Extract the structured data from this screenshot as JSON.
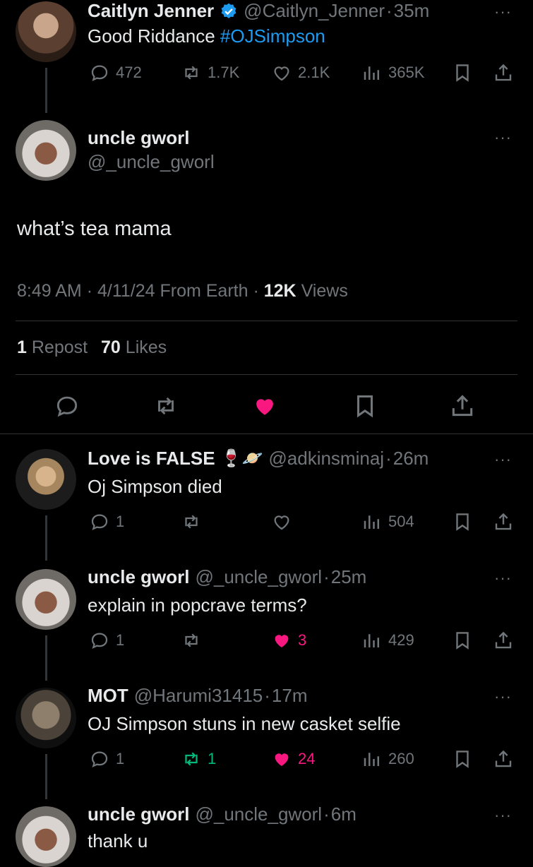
{
  "posts": [
    {
      "name": "Caitlyn Jenner",
      "handle": "@Caitlyn_Jenner",
      "time": "35m",
      "text": "Good Riddance ",
      "hashtag": "#OJSimpson",
      "replies": "472",
      "reposts": "1.7K",
      "likes": "2.1K",
      "views": "365K",
      "verified": true
    }
  ],
  "main": {
    "name": "uncle gworl",
    "handle": "@_uncle_gworl",
    "text": "what’s tea mama",
    "time": "8:49 AM",
    "date": "4/11/24",
    "source": "From Earth",
    "views_count": "12K",
    "views_label": "Views",
    "reposts_count": "1",
    "reposts_label": "Repost",
    "likes_count": "70",
    "likes_label": "Likes"
  },
  "replies": [
    {
      "name": "Love is FALSE",
      "emojis": "🍷🪐",
      "handle": "@adkinsminaj",
      "time": "26m",
      "text": "Oj Simpson died",
      "replies": "1",
      "reposts": "",
      "likes": "",
      "views": "504"
    },
    {
      "name": "uncle gworl",
      "handle": "@_uncle_gworl",
      "time": "25m",
      "text": "explain in popcrave terms?",
      "replies": "1",
      "reposts": "",
      "likes": "3",
      "views": "429"
    },
    {
      "name": "MOT",
      "handle": "@Harumi31415",
      "time": "17m",
      "text": "OJ Simpson stuns in new casket selfie",
      "replies": "1",
      "reposts": "1",
      "likes": "24",
      "views": "260"
    },
    {
      "name": "uncle gworl",
      "handle": "@_uncle_gworl",
      "time": "6m",
      "text": "thank u"
    }
  ],
  "separator": "·",
  "more": "···",
  "colors": {
    "background": "#000000",
    "text": "#e7e9ea",
    "muted": "#71767b",
    "link": "#1d9bf0",
    "like": "#f91880",
    "repost": "#00ba7c",
    "divider": "#2f3336"
  }
}
